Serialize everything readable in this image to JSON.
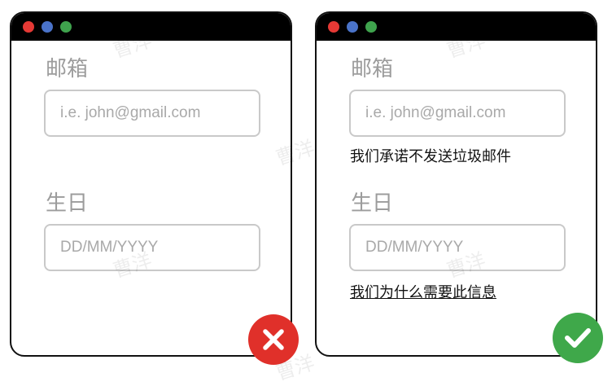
{
  "colors": {
    "traffic_red": "#e53935",
    "traffic_blue": "#4a73c9",
    "traffic_green": "#3fa34d",
    "bad_badge": "#e0302a",
    "good_badge": "#3fa84a"
  },
  "bad_example": {
    "email_label": "邮箱",
    "email_placeholder": "i.e. john@gmail.com",
    "birthday_label": "生日",
    "birthday_placeholder": "DD/MM/YYYY",
    "result_icon": "cross-icon"
  },
  "good_example": {
    "email_label": "邮箱",
    "email_placeholder": "i.e. john@gmail.com",
    "email_helper": "我们承诺不发送垃圾邮件",
    "birthday_label": "生日",
    "birthday_placeholder": "DD/MM/YYYY",
    "birthday_link": "我们为什么需要此信息",
    "result_icon": "checkmark-icon"
  },
  "watermark": "曹洋"
}
